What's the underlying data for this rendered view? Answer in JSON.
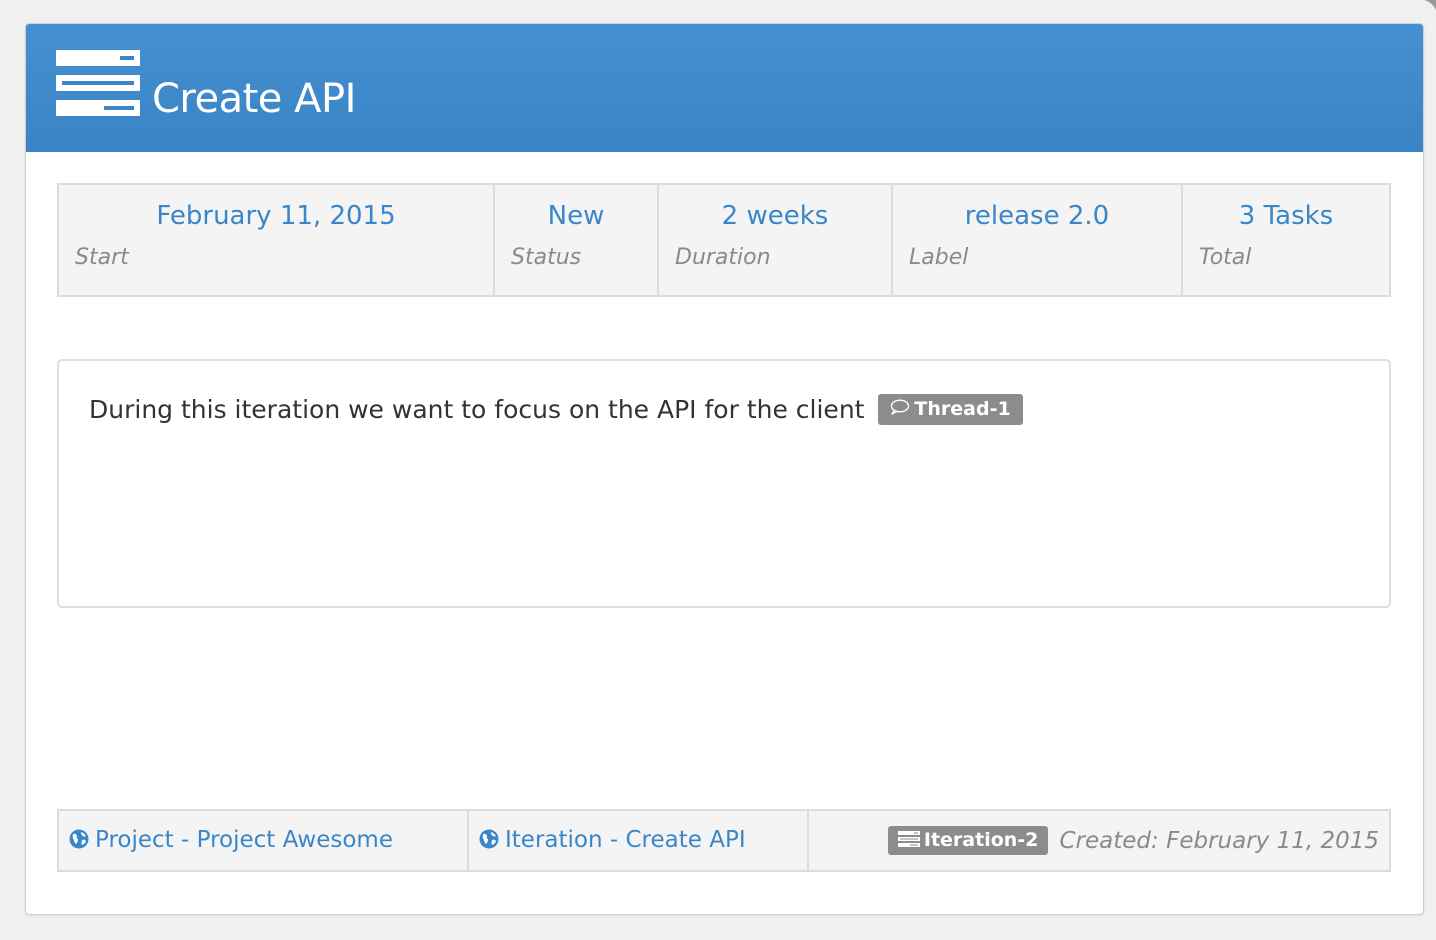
{
  "header": {
    "icon": "iteration-stack-icon",
    "title": "Create API"
  },
  "stats": [
    {
      "value": "February 11, 2015",
      "label": "Start"
    },
    {
      "value": "New",
      "label": "Status"
    },
    {
      "value": "2 weeks",
      "label": "Duration"
    },
    {
      "value": "release 2.0",
      "label": "Label"
    },
    {
      "value": "3 Tasks",
      "label": "Total"
    }
  ],
  "description": {
    "text": "During this iteration we want to focus on the API for the client",
    "thread_badge": "Thread-1",
    "thread_icon": "comment-icon"
  },
  "footer": {
    "project_link": "Project - Project Awesome",
    "iteration_link": "Iteration - Create API",
    "link_icon": "globe-icon",
    "iteration_badge": "Iteration-2",
    "created": "Created: February 11, 2015"
  },
  "colors": {
    "header_bg": "#3a86c8",
    "link": "#3a86c8",
    "badge_bg": "#8c8c8c",
    "muted": "#8a8a8a"
  }
}
